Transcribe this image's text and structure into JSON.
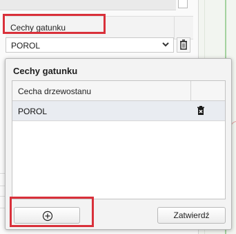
{
  "background": {
    "header_label": "Cechy gatunku",
    "select_value": "POROL",
    "select_arrow_icon": "chevron-down-icon",
    "trash_icon": "trash-icon"
  },
  "dialog": {
    "title": "Cechy gatunku",
    "table": {
      "column_header": "Cecha drzewostanu",
      "rows": [
        {
          "label": "POROL",
          "action_icon": "delete-icon"
        }
      ]
    },
    "add_button_icon": "plus-circle-icon",
    "confirm_label": "Zatwierdź"
  },
  "colors": {
    "highlight": "#d9303a",
    "selected_row": "#e9ecf1"
  }
}
